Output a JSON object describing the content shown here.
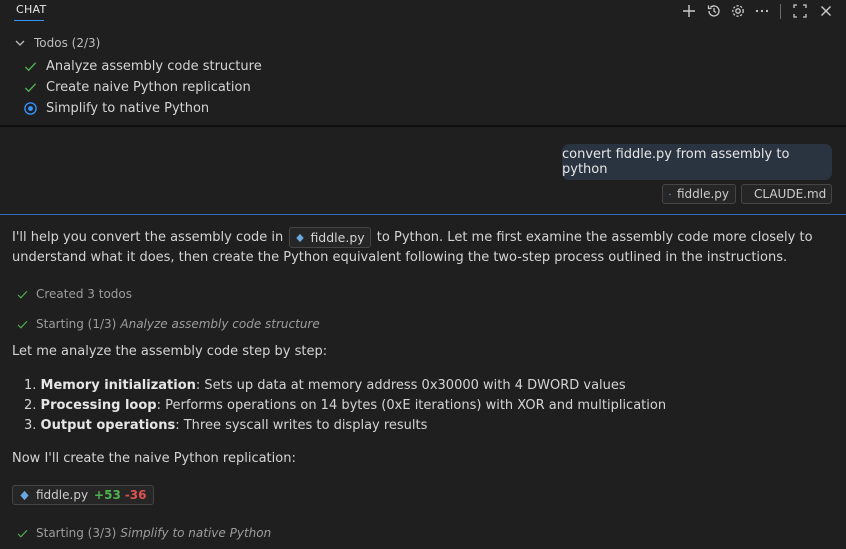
{
  "header": {
    "tab_label": "CHAT",
    "icons": [
      "plus-icon",
      "history-icon",
      "gear-icon",
      "more-icon",
      "maximize-icon",
      "close-icon"
    ]
  },
  "todos": {
    "title": "Todos (2/3)",
    "items": [
      {
        "label": "Analyze assembly code structure",
        "state": "done"
      },
      {
        "label": "Create naive Python replication",
        "state": "done"
      },
      {
        "label": "Simplify to native Python",
        "state": "in-progress"
      }
    ]
  },
  "user_message": {
    "text": "convert fiddle.py from assembly to python",
    "attachments": [
      {
        "name": "fiddle.py",
        "icon": "python-file-icon"
      },
      {
        "name": "CLAUDE.md",
        "icon": "markdown-file-icon"
      }
    ]
  },
  "response": {
    "intro_before": "I'll help you convert the assembly code in",
    "intro_file": "fiddle.py",
    "intro_after": "to Python. Let me first examine the assembly code more closely to understand what it does, then create the Python equivalent following the two-step process outlined in the instructions.",
    "status_created": "Created 3 todos",
    "status_starting_1_prefix": "Starting (1/3)",
    "status_starting_1_task": "Analyze assembly code structure",
    "analyze_text": "Let me analyze the assembly code step by step:",
    "list": [
      {
        "num": "1.",
        "bold": "Memory initialization",
        "rest": ": Sets up data at memory address 0x30000 with 4 DWORD values"
      },
      {
        "num": "2.",
        "bold": "Processing loop",
        "rest": ": Performs operations on 14 bytes (0xE iterations) with XOR and multiplication"
      },
      {
        "num": "3.",
        "bold": "Output operations",
        "rest": ": Three syscall writes to display results"
      }
    ],
    "create_text": "Now I'll create the naive Python replication:",
    "diff": {
      "file": "fiddle.py",
      "added": "+53",
      "removed": "-36"
    },
    "status_starting_3_prefix": "Starting (3/3)",
    "status_starting_3_task": "Simplify to native Python"
  },
  "colors": {
    "accent": "#3794ff",
    "check": "#4fb34f",
    "added": "#4fb34f",
    "removed": "#e05151"
  }
}
